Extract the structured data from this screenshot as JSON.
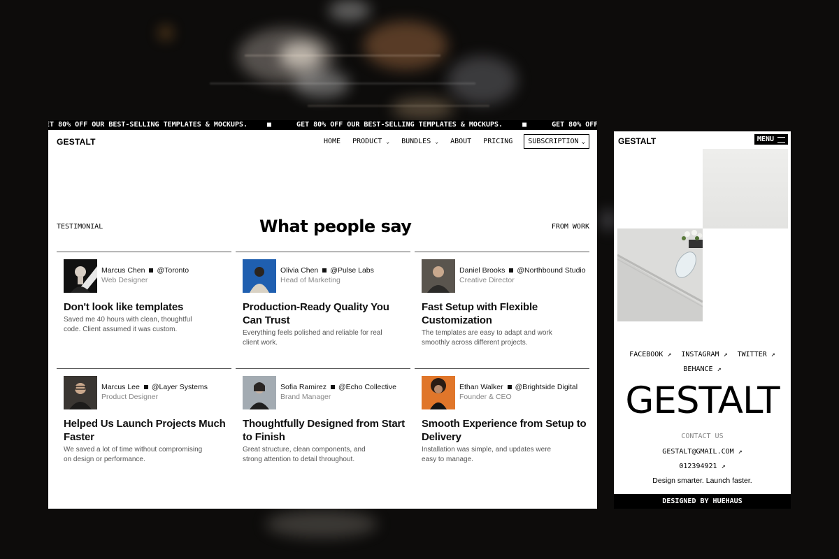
{
  "ticker": {
    "text": "GET 80% OFF OUR BEST-SELLING TEMPLATES & MOCKUPS.",
    "dot": "■"
  },
  "nav": {
    "logo": "GESTALT",
    "items": [
      {
        "label": "HOME",
        "dropdown": false
      },
      {
        "label": "PRODUCT",
        "dropdown": true
      },
      {
        "label": "BUNDLES",
        "dropdown": true
      },
      {
        "label": "ABOUT",
        "dropdown": false
      },
      {
        "label": "PRICING",
        "dropdown": false
      }
    ],
    "subscription": "SUBSCRIPTION"
  },
  "section": {
    "label": "TESTIMONIAL",
    "title": "What people say",
    "link": "FROM WORK"
  },
  "testimonials": [
    {
      "name": "Marcus Chen",
      "handle": "@Toronto",
      "role": "Web Designer",
      "title": "Don't look like templates",
      "body": "Saved me 40 hours with clean, thoughtful code. Client assumed it was custom.",
      "avatar_color": "#1a1a1a"
    },
    {
      "name": "Olivia Chen",
      "handle": "@Pulse Labs",
      "role": "Head of Marketing",
      "title": "Production-Ready Quality You Can Trust",
      "body": "Everything feels polished and reliable for real client work.",
      "avatar_color": "#1f5fb0"
    },
    {
      "name": "Daniel Brooks",
      "handle": "@Northbound Studio",
      "role": "Creative Director",
      "title": "Fast Setup with Flexible Customization",
      "body": "The templates are easy to adapt and work smoothly across different projects.",
      "avatar_color": "#4a4640"
    },
    {
      "name": "Marcus Lee",
      "handle": "@Layer Systems",
      "role": "Product Designer",
      "title": "Helped Us Launch Projects Much Faster",
      "body": "We saved a lot of time without compromising on design or performance.",
      "avatar_color": "#3a3632"
    },
    {
      "name": "Sofia Ramirez",
      "handle": "@Echo Collective",
      "role": "Brand Manager",
      "title": "Thoughtfully Designed from Start to Finish",
      "body": "Great structure, clean components, and strong attention to detail throughout.",
      "avatar_color": "#9aa3ab"
    },
    {
      "name": "Ethan Walker",
      "handle": "@Brightside Digital",
      "role": "Founder & CEO",
      "title": "Smooth Experience from Setup to Delivery",
      "body": "Installation was simple, and updates were easy to manage.",
      "avatar_color": "#e0762a"
    }
  ],
  "mobile": {
    "logo": "GESTALT",
    "menu": "MENU",
    "social": [
      "FACEBOOK ↗",
      "INSTAGRAM ↗",
      "TWITTER ↗",
      "BEHANCE ↗"
    ],
    "big": "GESTALT",
    "contact_label": "CONTACT US",
    "email": "GESTALT@GMAIL.COM ↗",
    "phone": "012394921 ↗",
    "tagline": "Design smarter. Launch faster.",
    "footer": "DESIGNED BY HUEHAUS"
  }
}
